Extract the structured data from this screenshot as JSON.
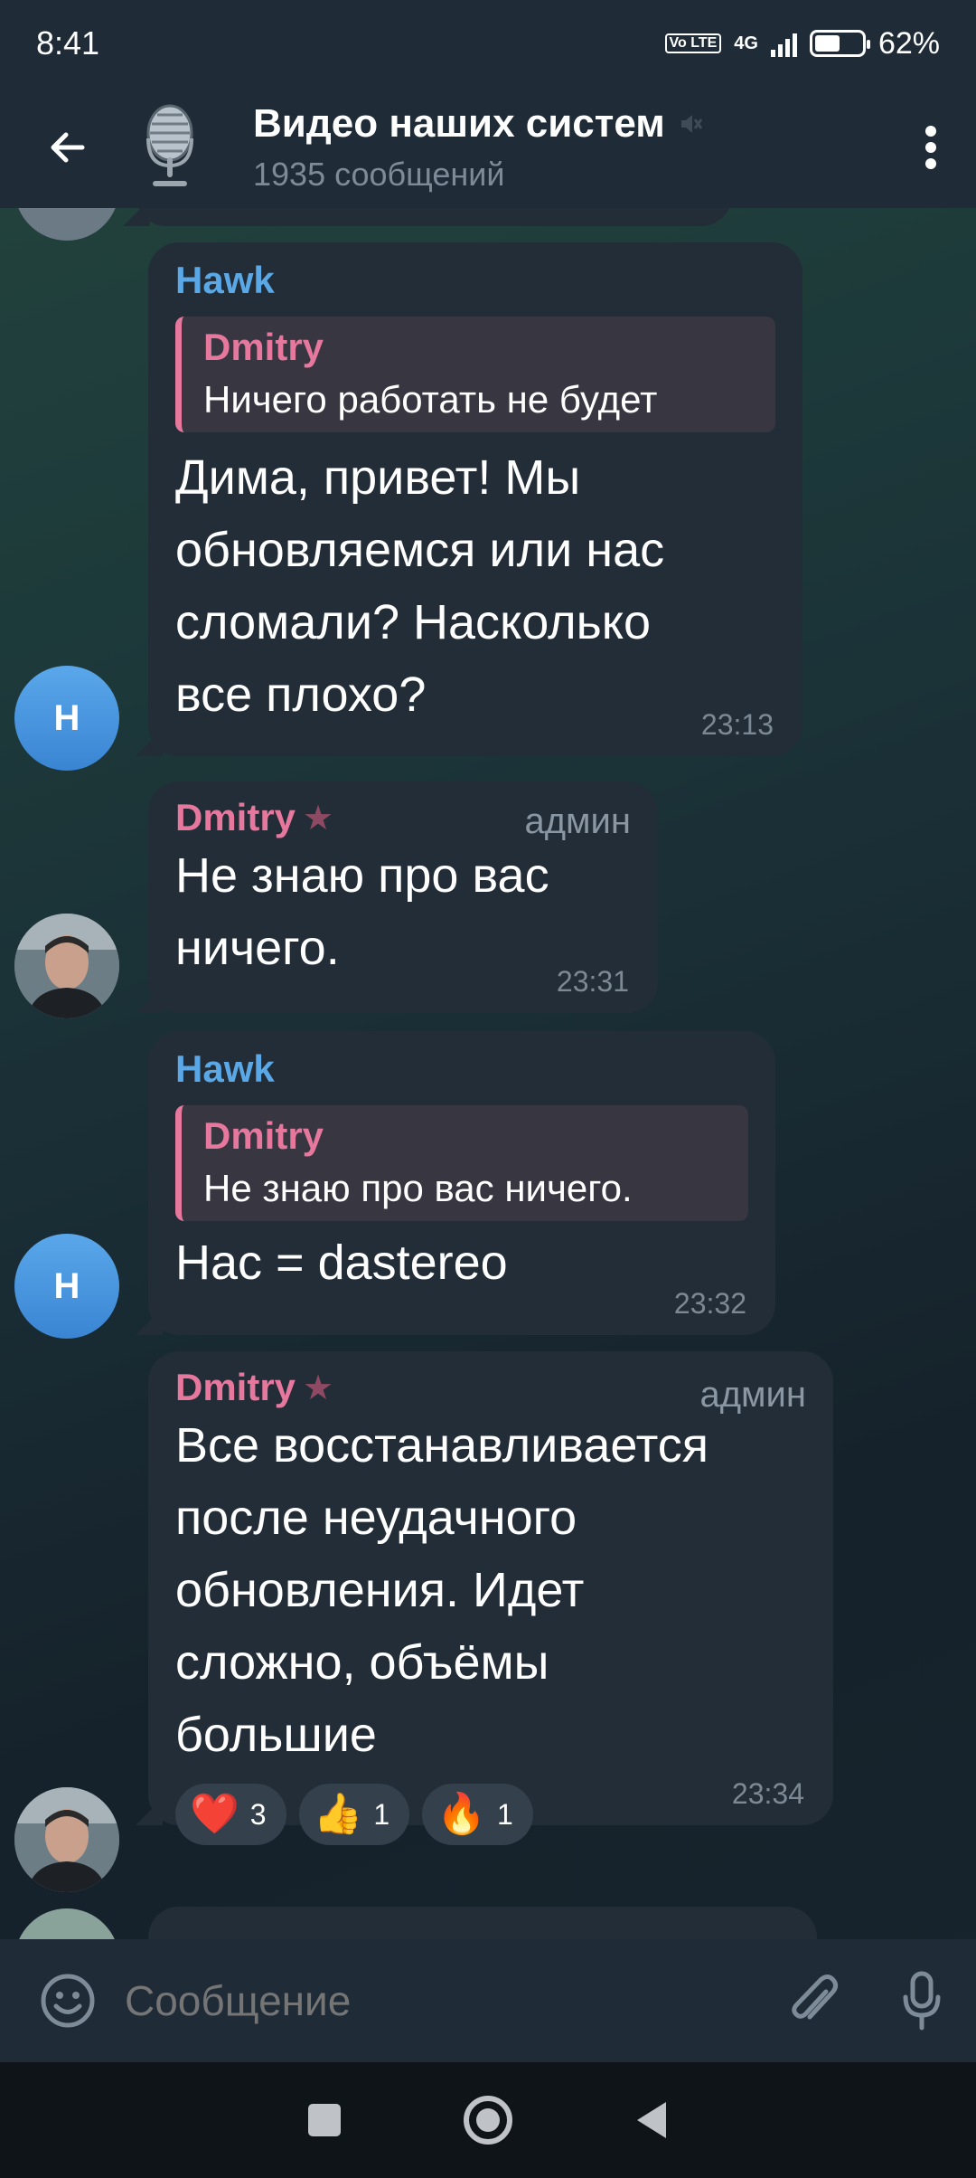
{
  "status_bar": {
    "time": "8:41",
    "network": "4G",
    "volte": "Vo LTE",
    "battery": "62%"
  },
  "header": {
    "back_icon": "arrow-left-icon",
    "title": "Видео наших систем",
    "muted_icon": "muted-icon",
    "subtitle": "1935 сообщений",
    "menu_icon": "more-vertical-icon"
  },
  "messages": [
    {
      "sender": "Hawk",
      "avatar_letter": "H",
      "reply": {
        "name": "Dmitry",
        "text": "Ничего работать не будет"
      },
      "lines": [
        "Дима, привет! Мы",
        "обновляемся или нас",
        "сломали? Насколько",
        "все плохо?"
      ],
      "time": "23:13"
    },
    {
      "sender": "Dmitry",
      "role": "админ",
      "lines": [
        "Не знаю про вас",
        "ничего."
      ],
      "time": "23:31"
    },
    {
      "sender": "Hawk",
      "avatar_letter": "H",
      "reply": {
        "name": "Dmitry",
        "text": "Не знаю про вас ничего."
      },
      "lines": [
        "Нас = dastereo"
      ],
      "time": "23:32"
    },
    {
      "sender": "Dmitry",
      "role": "админ",
      "lines": [
        "Все восстанавливается",
        "после неудачного",
        "обновления. Идет",
        "сложно, объёмы",
        "большие"
      ],
      "reactions": [
        {
          "emoji": "❤️",
          "icon": "heart-icon",
          "count": "3"
        },
        {
          "emoji": "👍",
          "icon": "thumbs-up-icon",
          "count": "1"
        },
        {
          "emoji": "🔥",
          "icon": "fire-icon",
          "count": "1"
        }
      ],
      "time": "23:34"
    }
  ],
  "input": {
    "placeholder": "Сообщение",
    "emoji_icon": "emoji-icon",
    "attach_icon": "paperclip-icon",
    "mic_icon": "microphone-icon"
  },
  "colors": {
    "hawk": "#5ba8e6",
    "dmitry": "#e6779d",
    "bubble": "#222d37",
    "header": "#1f2b36"
  }
}
